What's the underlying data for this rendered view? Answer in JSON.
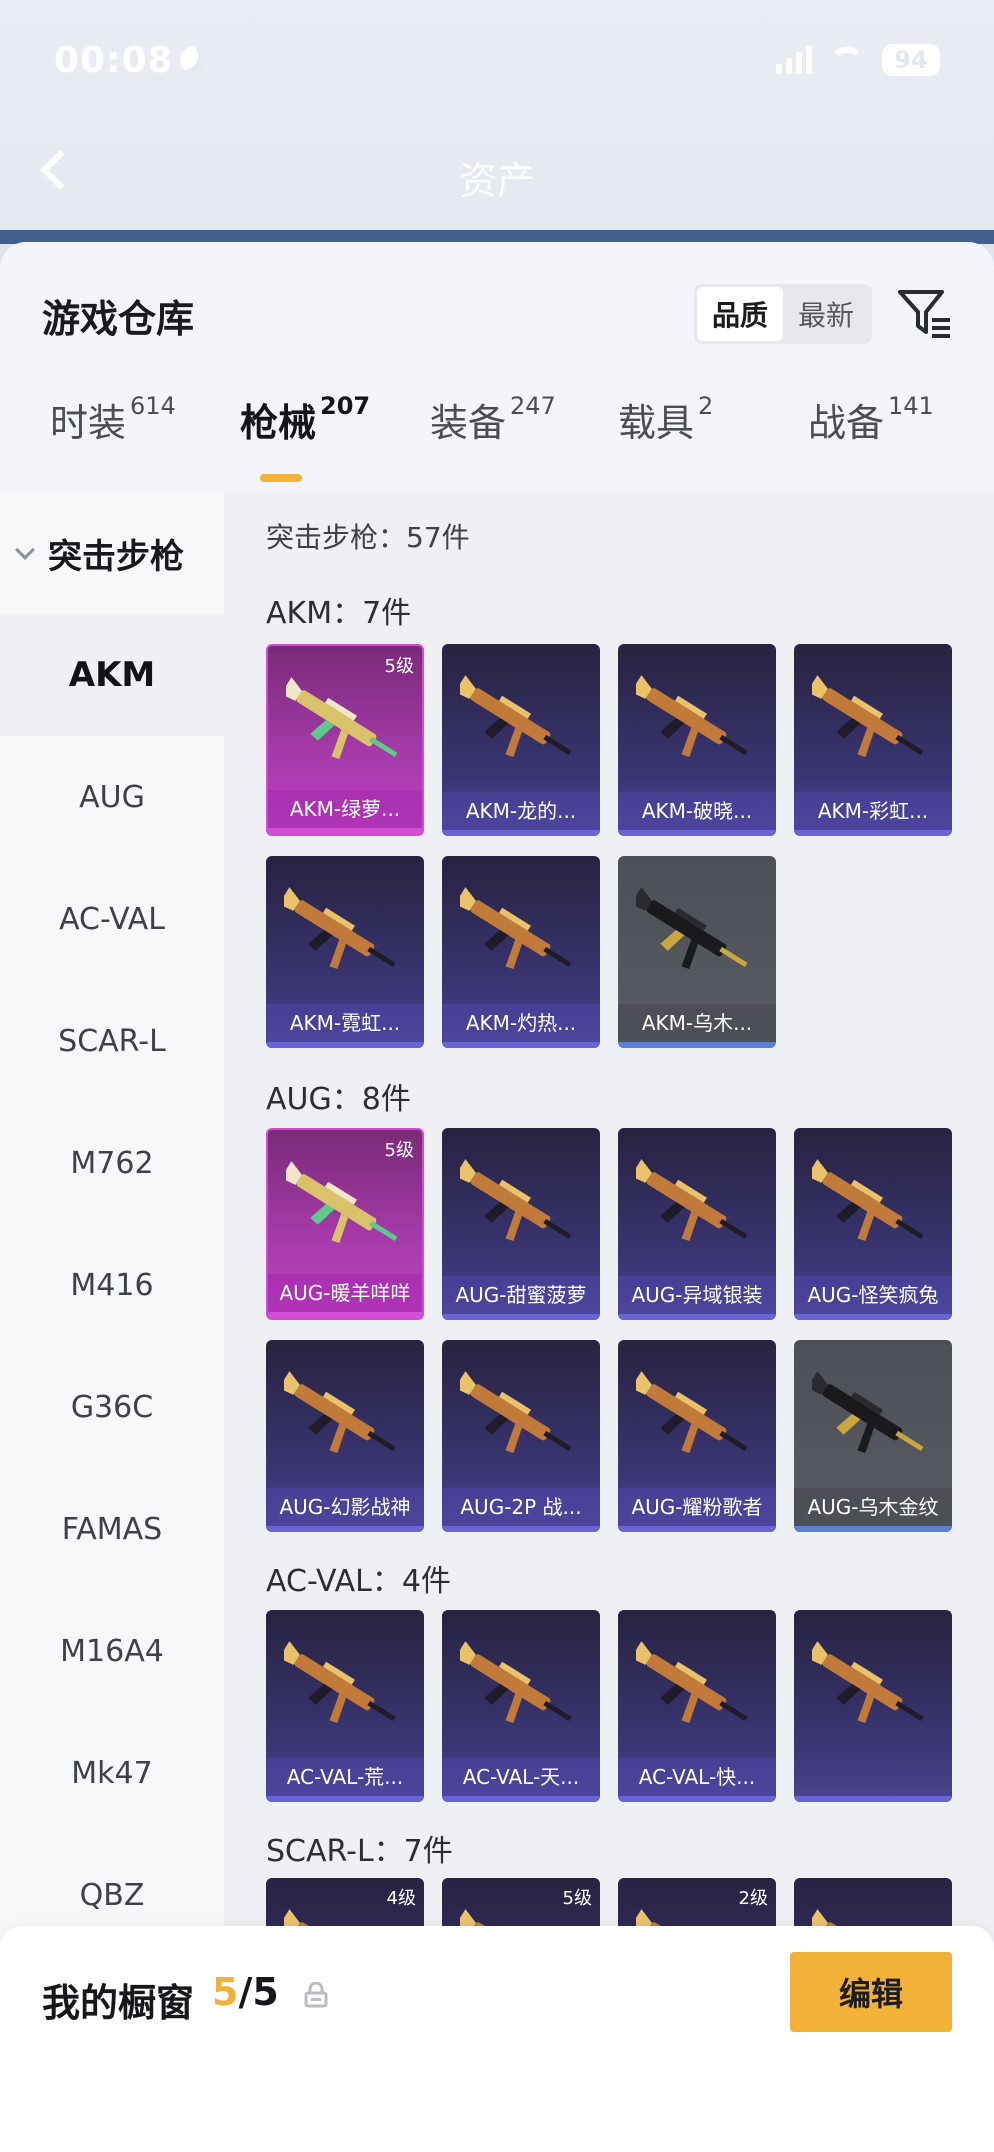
{
  "status_bar": {
    "time": "00:08",
    "battery": "94"
  },
  "background_header": {
    "title": "资产"
  },
  "sheet": {
    "title": "游戏仓库",
    "sort_options": [
      {
        "label": "品质",
        "active": true
      },
      {
        "label": "最新",
        "active": false
      }
    ],
    "filter_icon": "filter-icon"
  },
  "tabs": [
    {
      "label": "时装",
      "count": "614"
    },
    {
      "label": "枪械",
      "count": "207",
      "active": true
    },
    {
      "label": "装备",
      "count": "247"
    },
    {
      "label": "载具",
      "count": "2"
    },
    {
      "label": "战备",
      "count": "141"
    }
  ],
  "side": {
    "group": "突击步枪",
    "items": [
      "AKM",
      "AUG",
      "AC-VAL",
      "SCAR-L",
      "M762",
      "M416",
      "G36C",
      "FAMAS",
      "M16A4",
      "Mk47",
      "QBZ"
    ]
  },
  "content": {
    "category_total": "突击步枪：57件",
    "sections": [
      {
        "title": "AKM：7件",
        "items": [
          {
            "name": "AKM-绿萝...",
            "level": "5级",
            "tier": "gold"
          },
          {
            "name": "AKM-龙的...",
            "tier": "purple"
          },
          {
            "name": "AKM-破晓...",
            "tier": "purple"
          },
          {
            "name": "AKM-彩虹...",
            "tier": "purple"
          },
          {
            "name": "AKM-霓虹...",
            "tier": "purple"
          },
          {
            "name": "AKM-灼热...",
            "tier": "purple"
          },
          {
            "name": "AKM-乌木...",
            "tier": "grey"
          }
        ]
      },
      {
        "title": "AUG：8件",
        "items": [
          {
            "name": "AUG-暖羊咩咩",
            "level": "5级",
            "tier": "gold"
          },
          {
            "name": "AUG-甜蜜菠萝",
            "tier": "purple"
          },
          {
            "name": "AUG-异域银装",
            "tier": "purple"
          },
          {
            "name": "AUG-怪笑疯兔",
            "tier": "purple"
          },
          {
            "name": "AUG-幻影战神",
            "tier": "purple"
          },
          {
            "name": "AUG-2P 战...",
            "tier": "purple"
          },
          {
            "name": "AUG-耀粉歌者",
            "tier": "purple"
          },
          {
            "name": "AUG-乌木金纹",
            "tier": "grey"
          }
        ]
      },
      {
        "title": "AC-VAL：4件",
        "items": [
          {
            "name": "AC-VAL-荒...",
            "tier": "purple"
          },
          {
            "name": "AC-VAL-天...",
            "tier": "purple"
          },
          {
            "name": "AC-VAL-快...",
            "tier": "purple"
          },
          {
            "name": "",
            "tier": "purple"
          }
        ]
      },
      {
        "title": "SCAR-L：7件",
        "items": [
          {
            "name": "",
            "level": "4级",
            "tier": "purple"
          },
          {
            "name": "",
            "level": "5级",
            "tier": "purple"
          },
          {
            "name": "",
            "level": "2级",
            "tier": "purple"
          },
          {
            "name": "",
            "tier": "purple"
          }
        ]
      }
    ]
  },
  "bottom": {
    "label": "我的橱窗",
    "count_current": "5",
    "count_total": "/5",
    "edit_label": "编辑"
  }
}
